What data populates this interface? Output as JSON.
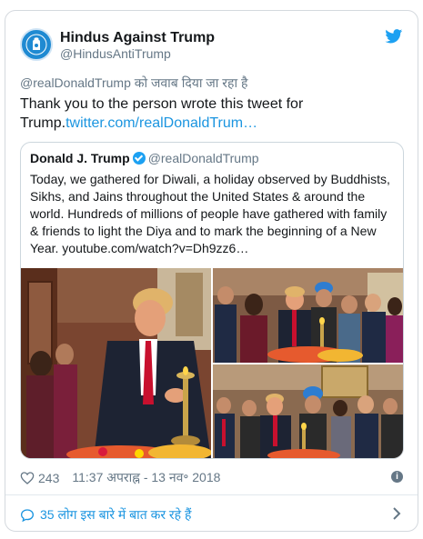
{
  "tweet": {
    "author_name": "Hindus Against Trump",
    "author_handle": "@HindusAntiTrump",
    "replying_to": "@realDonaldTrump को जवाब दिया जा रहा है",
    "text": "Thank you to the person wrote this tweet for Trump.",
    "link_text": "twitter.com/realDonaldTrum…",
    "likes": "243",
    "timestamp": "11:37 अपराह्न - 13 नव॰ 2018",
    "conversation": "35 लोग इस बारे में बात कर रहे हैं"
  },
  "quoted": {
    "name": "Donald J. Trump",
    "handle": "@realDonaldTrump",
    "text": "Today, we gathered for Diwali, a holiday observed by Buddhists, Sikhs, and Jains throughout the United States & around the world. Hundreds of millions of people have gathered with family & friends to light the Diya and to mark the beginning of a New Year. youtube.com/watch?v=Dh9zz6…"
  },
  "colors": {
    "link": "#1b95e0",
    "twitter_blue": "#1da1f2",
    "muted": "#657786"
  },
  "icons": [
    "avatar-logo",
    "twitter-bird-icon",
    "verified-badge-icon",
    "heart-icon",
    "info-icon",
    "speech-bubble-icon",
    "chevron-right-icon"
  ]
}
